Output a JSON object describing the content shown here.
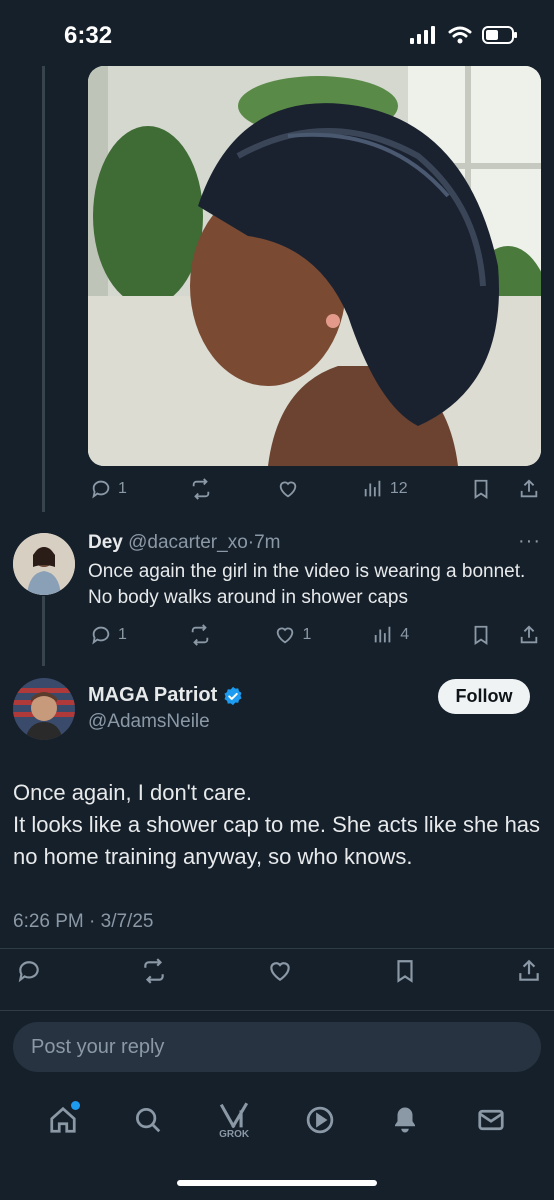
{
  "status_bar": {
    "time": "6:32"
  },
  "original_post": {
    "stats": {
      "replies": "1",
      "reposts": "",
      "likes": "",
      "views": "12"
    }
  },
  "reply": {
    "name": "Dey",
    "handle": "@dacarter_xo",
    "age": "7m",
    "text": "Once again the girl in the video is wearing a bonnet. No body walks around in shower caps",
    "stats": {
      "replies": "1",
      "reposts": "",
      "likes": "1",
      "views": "4"
    }
  },
  "main_post": {
    "name": "MAGA Patriot",
    "handle": "@AdamsNeile",
    "follow_label": "Follow",
    "text_line1": "Once again, I don't care.",
    "text_line2": "It looks like a shower cap to me. She acts like she has no home training anyway, so who knows.",
    "timestamp": "6:26 PM · 3/7/25"
  },
  "reply_box": {
    "placeholder": "Post your reply"
  },
  "nav": {
    "grok_label": "GROK"
  },
  "colors": {
    "background": "#15202b",
    "verified": "#1d9bf0",
    "muted": "#8b98a5"
  }
}
